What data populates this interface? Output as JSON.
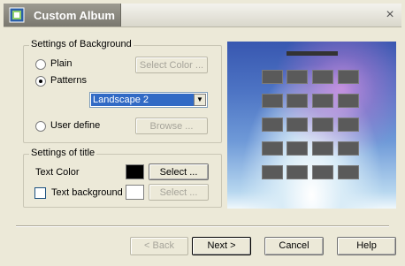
{
  "window": {
    "title": "Custom Album",
    "close_glyph": "×"
  },
  "background_group": {
    "title": "Settings of Background",
    "plain_label": "Plain",
    "patterns_label": "Patterns",
    "user_define_label": "User define",
    "selected": "patterns",
    "select_color_button": "Select Color ...",
    "pattern_value": "Landscape 2",
    "browse_button": "Browse ..."
  },
  "title_group": {
    "title": "Settings of title",
    "text_color_label": "Text Color",
    "text_color": "#000000",
    "text_color_select": "Select ...",
    "text_background_label": "Text background",
    "text_background_checked": false,
    "text_background_color": "#ffffff",
    "text_background_select": "Select ..."
  },
  "buttons": {
    "back": "< Back",
    "next": "Next >",
    "cancel": "Cancel",
    "help": "Help"
  },
  "icons": {
    "app": "album-icon",
    "close": "close-icon",
    "dropdown": "chevron-down-icon"
  },
  "colors": {
    "selection": "#316ac5",
    "dialog_bg": "#ece9d8"
  }
}
